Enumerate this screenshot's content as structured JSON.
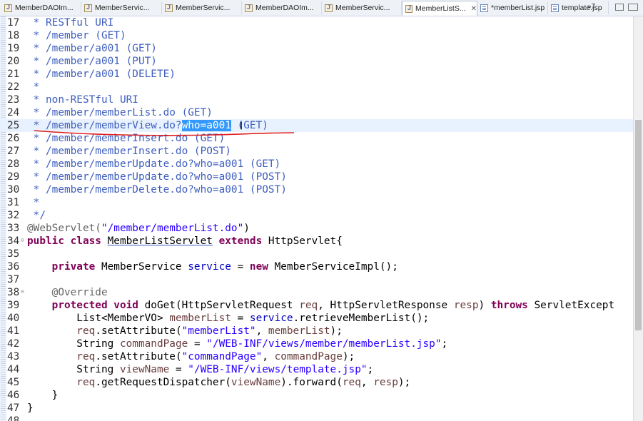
{
  "tabs": [
    {
      "label": "MemberDAOIm...",
      "type": "java",
      "active": false
    },
    {
      "label": "MemberServic...",
      "type": "java",
      "active": false
    },
    {
      "label": "MemberServic...",
      "type": "java",
      "active": false
    },
    {
      "label": "MemberDAOIm...",
      "type": "java",
      "active": false
    },
    {
      "label": "MemberServic...",
      "type": "java",
      "active": false
    },
    {
      "label": "MemberListS...",
      "type": "java",
      "active": true
    },
    {
      "label": "*memberList.jsp",
      "type": "jsp",
      "active": false
    },
    {
      "label": "template.jsp",
      "type": "jsp",
      "active": false
    }
  ],
  "overflow_label": "»7",
  "close_glyph": "✕",
  "lines": [
    {
      "n": "17",
      "t": " * RESTful URI"
    },
    {
      "n": "18",
      "t": " * /member (GET)"
    },
    {
      "n": "19",
      "t": " * /member/a001 (GET)"
    },
    {
      "n": "20",
      "t": " * /member/a001 (PUT)"
    },
    {
      "n": "21",
      "t": " * /member/a001 (DELETE)"
    },
    {
      "n": "22",
      "t": " *"
    },
    {
      "n": "23",
      "t": " * non-RESTful URI"
    },
    {
      "n": "24",
      "t": " * /member/memberList.do (GET)"
    },
    {
      "n": "25",
      "pre": " * /member/memberView.do?",
      "selected": "who=a001",
      "post": " (GET)"
    },
    {
      "n": "26",
      "t": " * /member/memberInsert.do (GET)"
    },
    {
      "n": "27",
      "t": " * /member/memberInsert.do (POST)"
    },
    {
      "n": "28",
      "t": " * /member/memberUpdate.do?who=a001 (GET)"
    },
    {
      "n": "29",
      "t": " * /member/memberUpdate.do?who=a001 (POST)"
    },
    {
      "n": "30",
      "t": " * /member/memberDelete.do?who=a001 (POST)"
    },
    {
      "n": "31",
      "t": " *"
    },
    {
      "n": "32",
      "t": " */"
    },
    {
      "n": "33",
      "ann": "@WebServlet(",
      "str": "\"/member/memberList.do\"",
      "rest": ")"
    },
    {
      "n": "34",
      "k1": "public class ",
      "cls": "MemberListServlet",
      "k2": " extends ",
      "rest": "HttpServlet{"
    },
    {
      "n": "35",
      "t": ""
    },
    {
      "n": "36",
      "k1": "    private ",
      "a": "MemberService ",
      "fld": "service",
      "b": " = ",
      "k2": "new ",
      "rest": "MemberServiceImpl();"
    },
    {
      "n": "37",
      "t": ""
    },
    {
      "n": "38",
      "ann": "    @Override"
    },
    {
      "n": "39",
      "k1": "    protected void ",
      "a": "doGet(HttpServletRequest ",
      "v1": "req",
      "b": ", HttpServletResponse ",
      "v2": "resp",
      "c": ") ",
      "k2": "throws ",
      "rest": "ServletExcept"
    },
    {
      "n": "40",
      "a": "        List<MemberVO> ",
      "v1": "memberList",
      "b": " = ",
      "fld": "service",
      "rest": ".retrieveMemberList();"
    },
    {
      "n": "41",
      "v1": "        req",
      "a": ".setAttribute(",
      "str": "\"memberList\"",
      "b": ", ",
      "v2": "memberList",
      "rest": ");"
    },
    {
      "n": "42",
      "a": "        String ",
      "v1": "commandPage",
      "b": " = ",
      "str": "\"/WEB-INF/views/member/memberList.jsp\"",
      "rest": ";"
    },
    {
      "n": "43",
      "v1": "        req",
      "a": ".setAttribute(",
      "str": "\"commandPage\"",
      "b": ", ",
      "v2": "commandPage",
      "rest": ");"
    },
    {
      "n": "44",
      "a": "        String ",
      "v1": "viewName",
      "b": " = ",
      "str": "\"/WEB-INF/views/template.jsp\"",
      "rest": ";"
    },
    {
      "n": "45",
      "v1": "        req",
      "a": ".getRequestDispatcher(",
      "v2": "viewName",
      "b": ").forward(",
      "v3": "req",
      "c": ", ",
      "v4": "resp",
      "rest": ");"
    },
    {
      "n": "46",
      "t": "    }"
    },
    {
      "n": "47",
      "t": "}"
    },
    {
      "n": "48",
      "t": ""
    }
  ]
}
